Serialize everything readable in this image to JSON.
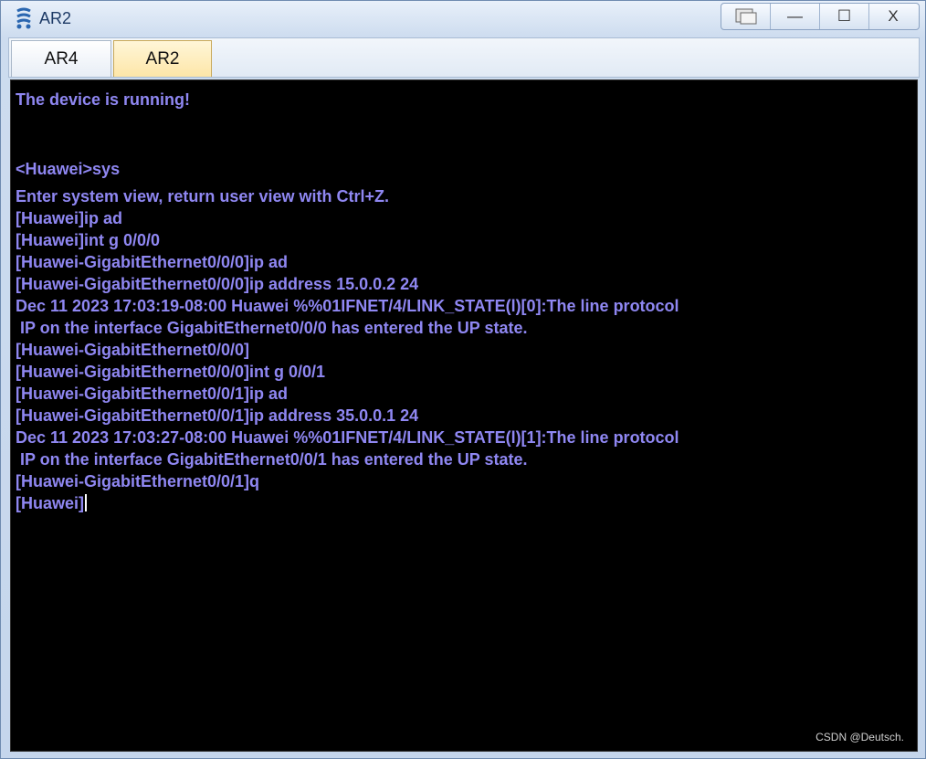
{
  "window": {
    "title": "AR2",
    "controls": {
      "restore_icon": "restore-windows-icon",
      "minimize": "—",
      "maximize": "☐",
      "close": "X"
    }
  },
  "tabs": [
    {
      "label": "AR4",
      "active": false
    },
    {
      "label": "AR2",
      "active": true
    }
  ],
  "terminal": {
    "text_color": "#8f87f2",
    "background": "#000000",
    "lines": [
      "The device is running!",
      "<Huawei>sys",
      "Enter system view, return user view with Ctrl+Z.",
      "[Huawei]ip ad",
      "[Huawei]int g 0/0/0",
      "[Huawei-GigabitEthernet0/0/0]ip ad",
      "[Huawei-GigabitEthernet0/0/0]ip address 15.0.0.2 24",
      "Dec 11 2023 17:03:19-08:00 Huawei %%01IFNET/4/LINK_STATE(l)[0]:The line protocol",
      " IP on the interface GigabitEthernet0/0/0 has entered the UP state.",
      "[Huawei-GigabitEthernet0/0/0]",
      "[Huawei-GigabitEthernet0/0/0]int g 0/0/1",
      "[Huawei-GigabitEthernet0/0/1]ip ad",
      "[Huawei-GigabitEthernet0/0/1]ip address 35.0.0.1 24",
      "Dec 11 2023 17:03:27-08:00 Huawei %%01IFNET/4/LINK_STATE(l)[1]:The line protocol",
      " IP on the interface GigabitEthernet0/0/1 has entered the UP state.",
      "[Huawei-GigabitEthernet0/0/1]q",
      "[Huawei]"
    ]
  },
  "watermark": "CSDN @Deutsch."
}
